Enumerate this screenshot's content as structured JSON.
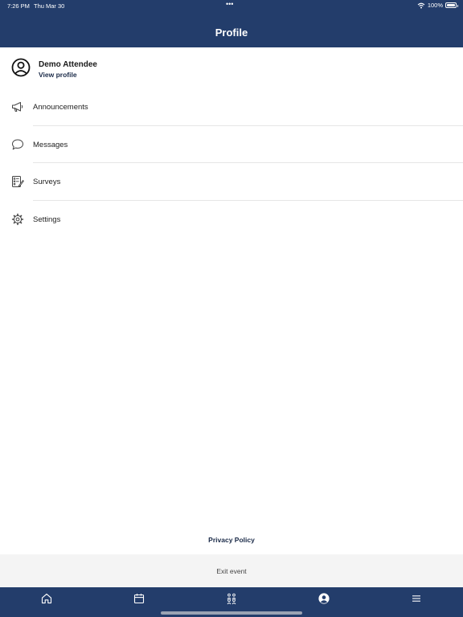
{
  "status_bar": {
    "time": "7:26 PM",
    "date": "Thu Mar 30",
    "dots": "•••",
    "battery": "100%",
    "battery_level": 1.0
  },
  "header": {
    "title": "Profile"
  },
  "profile": {
    "name": "Demo Attendee",
    "link": "View profile",
    "icon": "user-circle-icon"
  },
  "menu": [
    {
      "label": "Announcements",
      "icon": "megaphone-icon"
    },
    {
      "label": "Messages",
      "icon": "chat-bubble-icon"
    },
    {
      "label": "Surveys",
      "icon": "survey-icon"
    },
    {
      "label": "Settings",
      "icon": "gear-icon"
    }
  ],
  "footer": {
    "privacy": "Privacy Policy",
    "exit": "Exit event"
  },
  "tabbar": {
    "icons": [
      "home-icon",
      "calendar-icon",
      "people-icon",
      "profile-icon",
      "menu-icon"
    ],
    "active_index": 3
  },
  "colors": {
    "primary": "#233d6b",
    "background": "#ffffff",
    "exit_bar": "#f4f4f4"
  }
}
